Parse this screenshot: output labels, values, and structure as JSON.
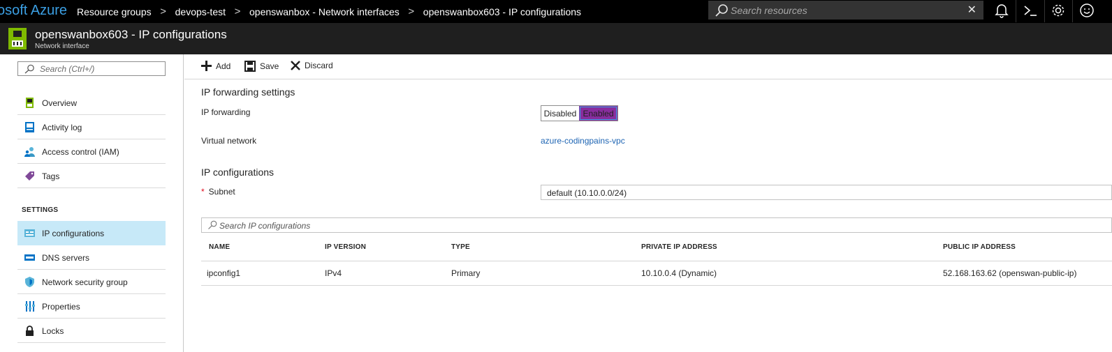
{
  "topbar": {
    "brand": "osoft Azure",
    "breadcrumbs": [
      "Resource groups",
      "devops-test",
      "openswanbox - Network interfaces",
      "openswanbox603 - IP configurations"
    ],
    "separator": ">",
    "search_placeholder": "Search resources",
    "clear_glyph": "✕",
    "icons": [
      "bell-icon",
      "cloud-shell-icon",
      "gear-icon",
      "smiley-icon"
    ]
  },
  "blade": {
    "title": "openswanbox603 - IP configurations",
    "subtitle": "Network interface"
  },
  "leftnav": {
    "search_placeholder": "Search (Ctrl+/)",
    "items": [
      {
        "label": "Overview",
        "icon": "nic-icon"
      },
      {
        "label": "Activity log",
        "icon": "activity-log-icon"
      },
      {
        "label": "Access control (IAM)",
        "icon": "iam-icon"
      },
      {
        "label": "Tags",
        "icon": "tag-icon"
      }
    ],
    "settings_heading": "SETTINGS",
    "settings_items": [
      {
        "label": "IP configurations",
        "icon": "ip-config-icon",
        "active": true
      },
      {
        "label": "DNS servers",
        "icon": "dns-icon"
      },
      {
        "label": "Network security group",
        "icon": "shield-icon"
      },
      {
        "label": "Properties",
        "icon": "properties-icon"
      },
      {
        "label": "Locks",
        "icon": "lock-icon"
      }
    ]
  },
  "commands": {
    "add": "Add",
    "save": "Save",
    "discard": "Discard"
  },
  "ip_forwarding": {
    "section_title": "IP forwarding settings",
    "label": "IP forwarding",
    "options": [
      "Disabled",
      "Enabled"
    ],
    "selected": "Enabled",
    "vnet_label": "Virtual network",
    "vnet_value": "azure-codingpains-vpc"
  },
  "ip_configurations": {
    "section_title": "IP configurations",
    "subnet_required": "*",
    "subnet_label": "Subnet",
    "subnet_value": "default (10.10.0.0/24)",
    "search_placeholder": "Search IP configurations",
    "columns": [
      "NAME",
      "IP VERSION",
      "TYPE",
      "PRIVATE IP ADDRESS",
      "PUBLIC IP ADDRESS"
    ],
    "rows": [
      [
        "ipconfig1",
        "IPv4",
        "Primary",
        "10.10.0.4 (Dynamic)",
        "52.168.163.62 (openswan-public-ip)"
      ]
    ]
  },
  "colors": {
    "accent_blue": "#3b9fe3",
    "toggle_on": "#882d9e",
    "active_nav": "#c7e9f8",
    "link": "#1d64b3"
  }
}
